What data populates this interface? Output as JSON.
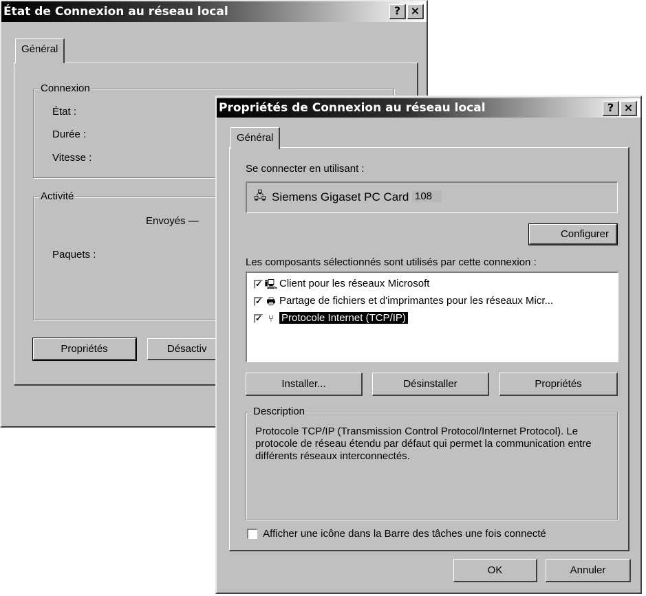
{
  "status_window": {
    "title": "État de Connexion au réseau local",
    "help_label": "?",
    "close_label": "×",
    "tab": "Général",
    "connexion_group": {
      "legend": "Connexion",
      "etat_label": "État :",
      "duree_label": "Durée :",
      "vitesse_label": "Vitesse :"
    },
    "activite_group": {
      "legend": "Activité",
      "envoyes_label": "Envoyés —",
      "paquets_label": "Paquets :"
    },
    "proprietes_button": "Propriétés",
    "desactiver_button": "Désactiv"
  },
  "props_window": {
    "title": "Propriétés de Connexion au réseau local",
    "help_label": "?",
    "close_label": "×",
    "tab": "Général",
    "connect_using_label": "Se connecter en utilisant :",
    "adapter": {
      "name": "Siemens Gigaset PC Card",
      "suffix": "108",
      "icon": "network-card-icon"
    },
    "configure_button": "Configurer",
    "components_label": "Les composants sélectionnés sont utilisés par cette connexion :",
    "components": [
      {
        "label": "Client pour les réseaux Microsoft",
        "checked": true,
        "icon": "computer-icon",
        "selected": false
      },
      {
        "label": "Partage de fichiers et d'imprimantes pour les réseaux Micr...",
        "checked": true,
        "icon": "printer-share-icon",
        "selected": false
      },
      {
        "label": "Protocole Internet (TCP/IP)",
        "checked": true,
        "icon": "protocol-icon",
        "selected": true
      }
    ],
    "install_button": "Installer...",
    "uninstall_button": "Désinstaller",
    "properties_button": "Propriétés",
    "description": {
      "legend": "Description",
      "text": "Protocole TCP/IP (Transmission Control Protocol/Internet Protocol). Le protocole de réseau étendu par défaut qui permet la communication entre différents réseaux interconnectés."
    },
    "show_icon_checkbox": {
      "label": "Afficher une icône dans la Barre des tâches une fois connecté",
      "checked": false
    },
    "ok_button": "OK",
    "cancel_button": "Annuler"
  },
  "colors": {
    "face": "#c0c0c0",
    "title_active_start": "#000000",
    "title_active_end": "#ffffff",
    "selection": "#000000"
  }
}
